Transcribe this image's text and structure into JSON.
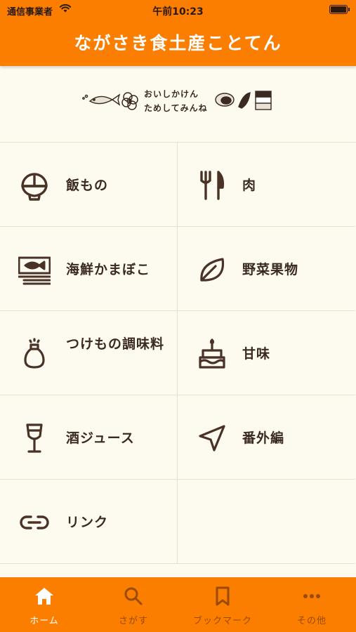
{
  "status_bar": {
    "carrier": "通信事業者",
    "time": "午前10:23"
  },
  "header": {
    "title": "ながさき食土産ことてん"
  },
  "banner": {
    "tagline_line1": "おいしかけん",
    "tagline_line2": "ためしてみんね"
  },
  "categories": [
    {
      "label": "飯もの",
      "icon": "rice-bowl-icon"
    },
    {
      "label": "肉",
      "icon": "fork-knife-icon"
    },
    {
      "label": "海鮮かまぼこ",
      "icon": "fish-sign-icon"
    },
    {
      "label": "野菜果物",
      "icon": "leaf-icon"
    },
    {
      "label": "つけもの調味料",
      "icon": "seasoning-bottle-icon"
    },
    {
      "label": "甘味",
      "icon": "cake-icon"
    },
    {
      "label": "酒ジュース",
      "icon": "wine-glass-icon"
    },
    {
      "label": "番外編",
      "icon": "location-arrow-icon"
    },
    {
      "label": "リンク",
      "icon": "link-icon"
    }
  ],
  "tabs": [
    {
      "label": "ホーム",
      "icon": "home-icon",
      "selected": true
    },
    {
      "label": "さがす",
      "icon": "search-icon",
      "selected": false
    },
    {
      "label": "ブックマーク",
      "icon": "bookmark-icon",
      "selected": false
    },
    {
      "label": "その他",
      "icon": "more-icon",
      "selected": false
    }
  ],
  "colors": {
    "brand": "#fb7e00",
    "background": "#fdfbef",
    "icon": "#4a3226",
    "tab_active": "#ffffff",
    "tab_inactive": "#9a4b00"
  }
}
